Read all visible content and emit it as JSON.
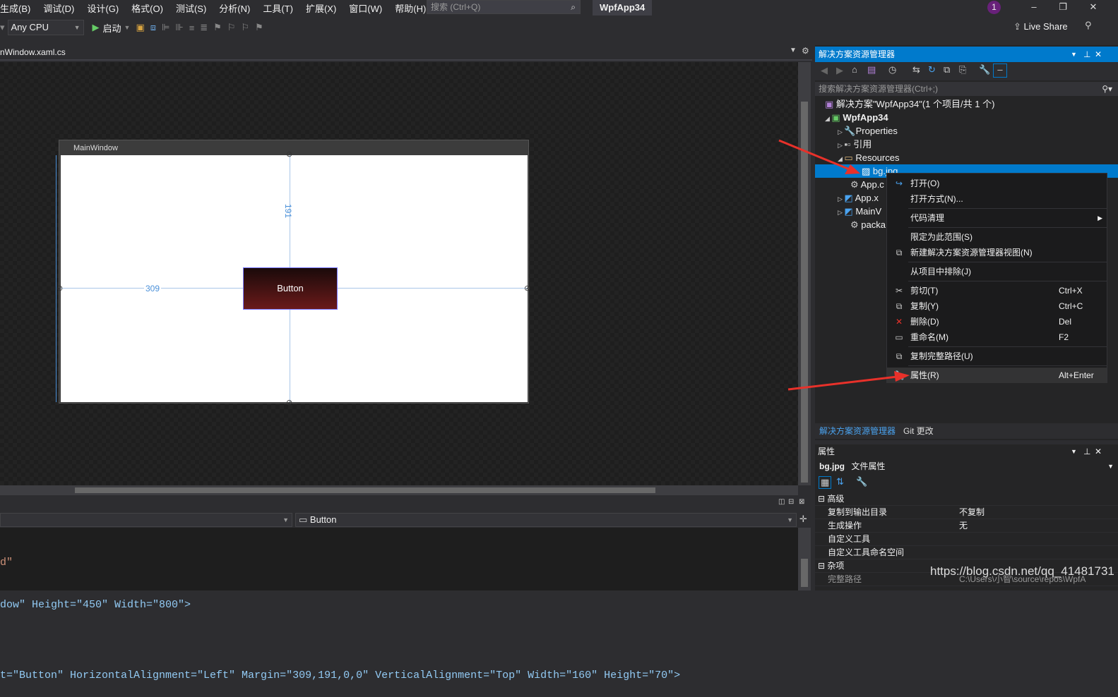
{
  "menubar": {
    "items": [
      "生成(B)",
      "调试(D)",
      "设计(G)",
      "格式(O)",
      "测试(S)",
      "分析(N)",
      "工具(T)",
      "扩展(X)",
      "窗口(W)",
      "帮助(H)"
    ],
    "search_placeholder": "搜索 (Ctrl+Q)",
    "app_title": "WpfApp34",
    "notification_count": "1",
    "minimize": "–",
    "restore": "❐",
    "close": "✕"
  },
  "toolbar": {
    "platform": "Any CPU",
    "start_label": "启动",
    "live_share": "Live Share"
  },
  "editor": {
    "active_tab": "nWindow.xaml.cs"
  },
  "designer": {
    "window_title": "MainWindow",
    "button_text": "Button",
    "top_margin_label": "191",
    "left_margin_label": "309"
  },
  "xaml": {
    "element_combo": "Button",
    "lines": [
      {
        "text": "d\""
      },
      {
        "text": "dow\" Height=\"450\" Width=\"800\">"
      },
      {
        "text": ""
      },
      {
        "text": "t=\"Button\" HorizontalAlignment=\"Left\" Margin=\"309,191,0,0\" VerticalAlignment=\"Top\" Width=\"160\" Height=\"70\">"
      }
    ]
  },
  "solution_explorer": {
    "title": "解决方案资源管理器",
    "search_placeholder": "搜索解决方案资源管理器(Ctrl+;)",
    "tree": [
      {
        "label": "解决方案\"WpfApp34\"(1 个项目/共 1 个)"
      },
      {
        "label": "WpfApp34"
      },
      {
        "label": "Properties"
      },
      {
        "label": "引用"
      },
      {
        "label": "Resources"
      },
      {
        "label": "bg.jpg"
      },
      {
        "label": "App.c"
      },
      {
        "label": "App.x"
      },
      {
        "label": "MainV"
      },
      {
        "label": "packa"
      }
    ],
    "tab_active": "解决方案资源管理器",
    "tab_other": "Git 更改"
  },
  "context_menu": {
    "items": [
      {
        "label": "打开(O)",
        "shortcut": ""
      },
      {
        "label": "打开方式(N)...",
        "shortcut": ""
      },
      {
        "label": "代码清理",
        "shortcut": ""
      },
      {
        "label": "限定为此范围(S)",
        "shortcut": ""
      },
      {
        "label": "新建解决方案资源管理器视图(N)",
        "shortcut": ""
      },
      {
        "label": "从项目中排除(J)",
        "shortcut": ""
      },
      {
        "label": "剪切(T)",
        "shortcut": "Ctrl+X"
      },
      {
        "label": "复制(Y)",
        "shortcut": "Ctrl+C"
      },
      {
        "label": "删除(D)",
        "shortcut": "Del"
      },
      {
        "label": "重命名(M)",
        "shortcut": "F2"
      },
      {
        "label": "复制完整路径(U)",
        "shortcut": ""
      },
      {
        "label": "属性(R)",
        "shortcut": "Alt+Enter"
      }
    ]
  },
  "properties": {
    "title": "属性",
    "object_name": "bg.jpg",
    "object_type": "文件属性",
    "section_advanced": "高级",
    "section_misc": "杂项",
    "rows": [
      {
        "name": "复制到输出目录",
        "value": "不复制"
      },
      {
        "name": "生成操作",
        "value": "无"
      },
      {
        "name": "自定义工具",
        "value": ""
      },
      {
        "name": "自定义工具命名空间",
        "value": ""
      }
    ],
    "misc_row_name": "完整路径",
    "misc_row_value": "C:\\Users\\小智\\source\\repos\\WpfA"
  },
  "watermark": "https://blog.csdn.net/qq_41481731",
  "colors": {
    "accent": "#007acc",
    "arrow": "#e8312a"
  }
}
